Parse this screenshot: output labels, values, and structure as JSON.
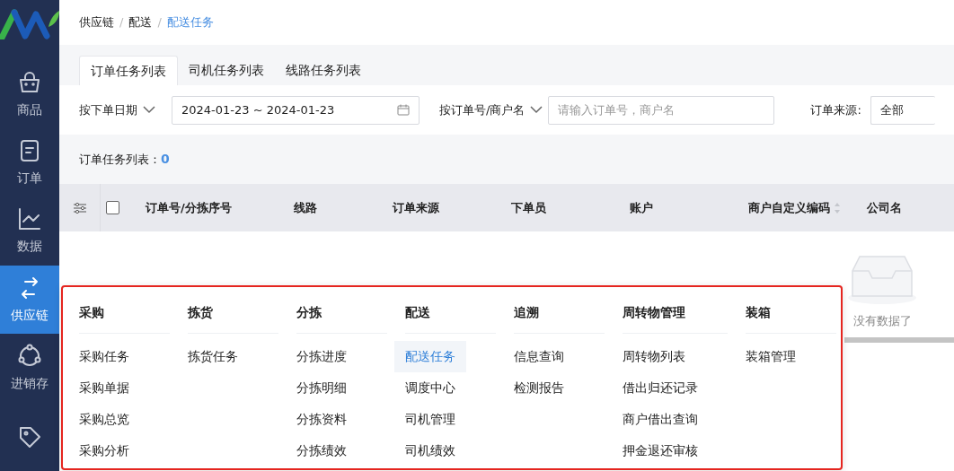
{
  "sidebar": {
    "items": [
      {
        "label": "商品",
        "selected": false
      },
      {
        "label": "订单",
        "selected": false
      },
      {
        "label": "数据",
        "selected": false
      },
      {
        "label": "供应链",
        "selected": true
      },
      {
        "label": "进销存",
        "selected": false
      },
      {
        "selected": false
      }
    ]
  },
  "breadcrumb_separators": [
    "/",
    "/"
  ],
  "breadcrumb": [
    {
      "label": "供应链",
      "current": false
    },
    {
      "label": "配送",
      "current": false
    },
    {
      "label": "配送任务",
      "current": true
    }
  ],
  "tabs": [
    {
      "label": "订单任务列表",
      "selected": true
    },
    {
      "label": "司机任务列表",
      "selected": false
    },
    {
      "label": "线路任务列表",
      "selected": false
    }
  ],
  "filters": {
    "date_mode": "按下单日期",
    "date_range": "2024-01-23 ~ 2024-01-23",
    "search_mode": "按订单号/商户名",
    "search": {
      "placeholder": "请输入订单号，商户名"
    },
    "source": {
      "label": "订单来源:",
      "value": "全部"
    }
  },
  "summary": {
    "label": "订单任务列表：",
    "count": "0"
  },
  "table": {
    "select_all": {
      "checked": false
    },
    "columns": [
      {
        "label": "订单号/分拣序号",
        "sortable": false
      },
      {
        "label": "线路",
        "sortable": false
      },
      {
        "label": "订单来源",
        "sortable": false
      },
      {
        "label": "下单员",
        "sortable": false
      },
      {
        "label": "账户",
        "sortable": false
      },
      {
        "label": "商户自定义编码",
        "sortable": true
      },
      {
        "label": "公司名",
        "sortable": false
      }
    ],
    "empty_text": "没有数据了"
  },
  "menu": {
    "columns": [
      {
        "title": "采购",
        "items": [
          {
            "label": "采购任务",
            "selected": false
          },
          {
            "label": "采购单据",
            "selected": false
          },
          {
            "label": "采购总览",
            "selected": false
          },
          {
            "label": "采购分析",
            "selected": false
          }
        ]
      },
      {
        "title": "拣货",
        "items": [
          {
            "label": "拣货任务",
            "selected": false
          }
        ]
      },
      {
        "title": "分拣",
        "items": [
          {
            "label": "分拣进度",
            "selected": false
          },
          {
            "label": "分拣明细",
            "selected": false
          },
          {
            "label": "分拣资料",
            "selected": false
          },
          {
            "label": "分拣绩效",
            "selected": false
          }
        ]
      },
      {
        "title": "配送",
        "items": [
          {
            "label": "配送任务",
            "selected": true
          },
          {
            "label": "调度中心",
            "selected": false
          },
          {
            "label": "司机管理",
            "selected": false
          },
          {
            "label": "司机绩效",
            "selected": false
          }
        ]
      },
      {
        "title": "追溯",
        "items": [
          {
            "label": "信息查询",
            "selected": false
          },
          {
            "label": "检测报告",
            "selected": false
          }
        ]
      },
      {
        "title": "周转物管理",
        "items": [
          {
            "label": "周转物列表",
            "selected": false
          },
          {
            "label": "借出归还记录",
            "selected": false
          },
          {
            "label": "商户借出查询",
            "selected": false
          },
          {
            "label": "押金退还审核",
            "selected": false
          }
        ]
      },
      {
        "title": "装箱",
        "items": [
          {
            "label": "装箱管理",
            "selected": false
          }
        ]
      }
    ]
  }
}
